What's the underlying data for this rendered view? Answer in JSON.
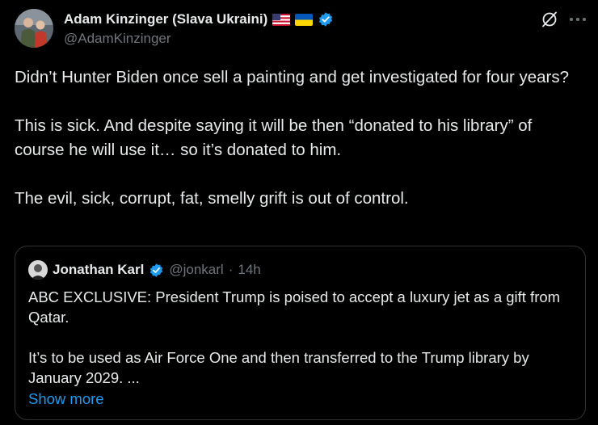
{
  "author": {
    "display_name": "Adam Kinzinger (Slava Ukraini)",
    "flags": [
      "us-flag-icon",
      "ukraine-flag-icon"
    ],
    "handle": "@AdamKinzinger",
    "verified": true
  },
  "post": {
    "paragraphs": [
      "Didn’t Hunter Biden once sell a painting and get investigated for four years?",
      "This is sick.  And despite saying it will be then “donated to his library” of course he will use it… so it’s donated to him.",
      "The evil, sick, corrupt, fat, smelly grift is out of control."
    ]
  },
  "quoted": {
    "display_name": "Jonathan Karl",
    "handle": "@jonkarl",
    "separator": "·",
    "time": "14h",
    "verified": true,
    "paragraphs": [
      "ABC EXCLUSIVE: President Trump is poised to accept a luxury jet as a gift from Qatar.",
      "It’s to be used as Air Force One and then transferred to the Trump library by January 2029. ..."
    ],
    "show_more": "Show more"
  },
  "icons": {
    "grok": "grok-icon",
    "more": "more-options-icon",
    "verified": "verified-badge-icon"
  },
  "colors": {
    "background": "#000000",
    "text": "#e7e9ea",
    "secondary_text": "#71767b",
    "link": "#1d9bf0",
    "verified": "#1d9bf0",
    "border": "#2f3336"
  }
}
